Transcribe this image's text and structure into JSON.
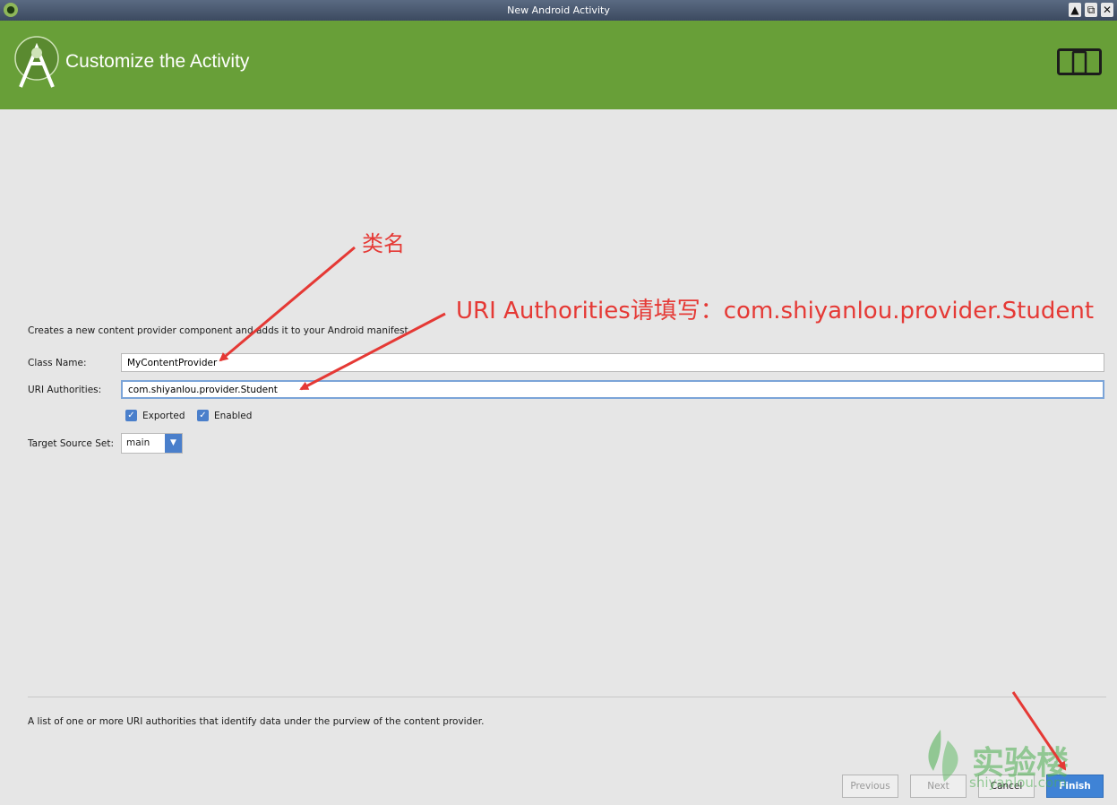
{
  "window": {
    "title": "New Android Activity"
  },
  "header": {
    "title": "Customize the Activity"
  },
  "form": {
    "description": "Creates a new content provider component and adds it to your Android manifest.",
    "class_name_label": "Class Name:",
    "class_name_value": "MyContentProvider",
    "uri_label": "URI Authorities:",
    "uri_value": "com.shiyanlou.provider.Student",
    "exported_label": "Exported",
    "exported_checked": true,
    "enabled_label": "Enabled",
    "enabled_checked": true,
    "source_set_label": "Target Source Set:",
    "source_set_value": "main"
  },
  "help_text": "A list of one or more URI authorities that identify data under the purview of the content provider.",
  "buttons": {
    "previous": "Previous",
    "next": "Next",
    "cancel": "Cancel",
    "finish": "Finish"
  },
  "annotations": {
    "class_name_note": "类名",
    "uri_note": "URI Authorities请填写：com.shiyanlou.provider.Student"
  },
  "watermark": {
    "chinese": "实验楼",
    "site": "shiyanlou.com"
  },
  "colors": {
    "header_bg": "#689f38",
    "accent": "#3f83d6",
    "annotation": "#e53935"
  }
}
